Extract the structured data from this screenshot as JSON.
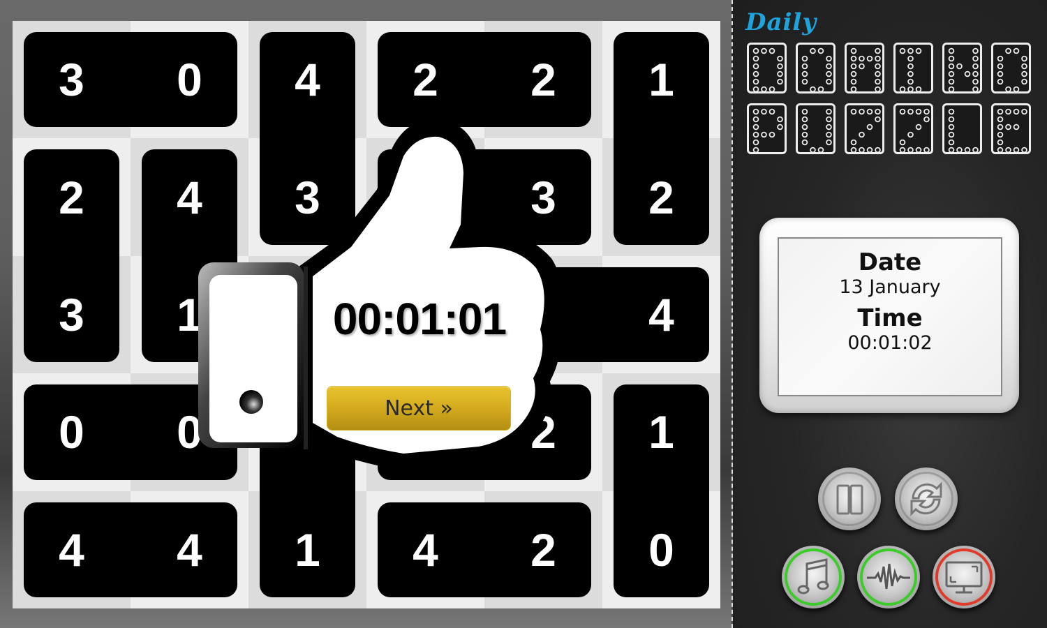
{
  "app": {
    "title_script": "Daily",
    "title_tiles_row1": [
      "D",
      "O",
      "M",
      "I",
      "N",
      "O"
    ],
    "title_tiles_row2": [
      "P",
      "U",
      "Z",
      "Z",
      "L",
      "E"
    ]
  },
  "board": {
    "columns": 6,
    "rows": 5,
    "cell_shades": [
      "#dcdcdc",
      "#eeeeee"
    ],
    "dominoes": [
      {
        "orientation": "horizontal",
        "cells": [
          [
            0,
            0
          ],
          [
            0,
            1
          ]
        ],
        "values": [
          "3",
          "0"
        ]
      },
      {
        "orientation": "vertical",
        "cells": [
          [
            0,
            2
          ],
          [
            1,
            2
          ]
        ],
        "values": [
          "4",
          "3"
        ]
      },
      {
        "orientation": "horizontal",
        "cells": [
          [
            0,
            3
          ],
          [
            0,
            4
          ]
        ],
        "values": [
          "2",
          "2"
        ]
      },
      {
        "orientation": "vertical",
        "cells": [
          [
            0,
            5
          ],
          [
            1,
            5
          ]
        ],
        "values": [
          "1",
          "2"
        ]
      },
      {
        "orientation": "vertical",
        "cells": [
          [
            1,
            0
          ],
          [
            2,
            0
          ]
        ],
        "values": [
          "2",
          "3"
        ]
      },
      {
        "orientation": "vertical",
        "cells": [
          [
            1,
            1
          ],
          [
            2,
            1
          ]
        ],
        "values": [
          "4",
          "1"
        ]
      },
      {
        "orientation": "horizontal",
        "cells": [
          [
            1,
            3
          ],
          [
            1,
            4
          ]
        ],
        "values": [
          "",
          "3"
        ]
      },
      {
        "orientation": "horizontal",
        "cells": [
          [
            2,
            4
          ],
          [
            2,
            5
          ]
        ],
        "values": [
          "",
          "4"
        ]
      },
      {
        "orientation": "horizontal",
        "cells": [
          [
            3,
            0
          ],
          [
            3,
            1
          ]
        ],
        "values": [
          "0",
          "0"
        ]
      },
      {
        "orientation": "horizontal",
        "cells": [
          [
            3,
            3
          ],
          [
            3,
            4
          ]
        ],
        "values": [
          "",
          "2"
        ]
      },
      {
        "orientation": "vertical",
        "cells": [
          [
            3,
            5
          ],
          [
            4,
            5
          ]
        ],
        "values": [
          "1",
          "0"
        ]
      },
      {
        "orientation": "horizontal",
        "cells": [
          [
            4,
            0
          ],
          [
            4,
            1
          ]
        ],
        "values": [
          "4",
          "4"
        ]
      },
      {
        "orientation": "vertical",
        "cells": [
          [
            3,
            2
          ],
          [
            4,
            2
          ]
        ],
        "values": [
          "",
          "1"
        ]
      },
      {
        "orientation": "horizontal",
        "cells": [
          [
            4,
            3
          ],
          [
            4,
            4
          ]
        ],
        "values": [
          "4",
          "2"
        ]
      }
    ]
  },
  "overlay": {
    "icon": "thumbs-up-icon",
    "completion_time": "00:01:01",
    "next_label": "Next »",
    "next_color": "#d4aa1e"
  },
  "info_panel": {
    "date_label": "Date",
    "date_value": "13 January",
    "time_label": "Time",
    "time_value": "00:01:02"
  },
  "controls": [
    {
      "name": "pause-button",
      "icon": "pause-icon",
      "ring": ""
    },
    {
      "name": "restart-button",
      "icon": "refresh-icon",
      "ring": ""
    },
    {
      "name": "music-toggle",
      "icon": "music-note-icon",
      "ring": "#3ccc2a"
    },
    {
      "name": "sound-toggle",
      "icon": "sound-wave-icon",
      "ring": "#3ccc2a"
    },
    {
      "name": "fullscreen-toggle",
      "icon": "monitor-icon",
      "ring": "#e03a2a"
    }
  ],
  "colors": {
    "accent": "#1fa3dc",
    "domino": "#000000",
    "pip_text": "#ffffff"
  }
}
